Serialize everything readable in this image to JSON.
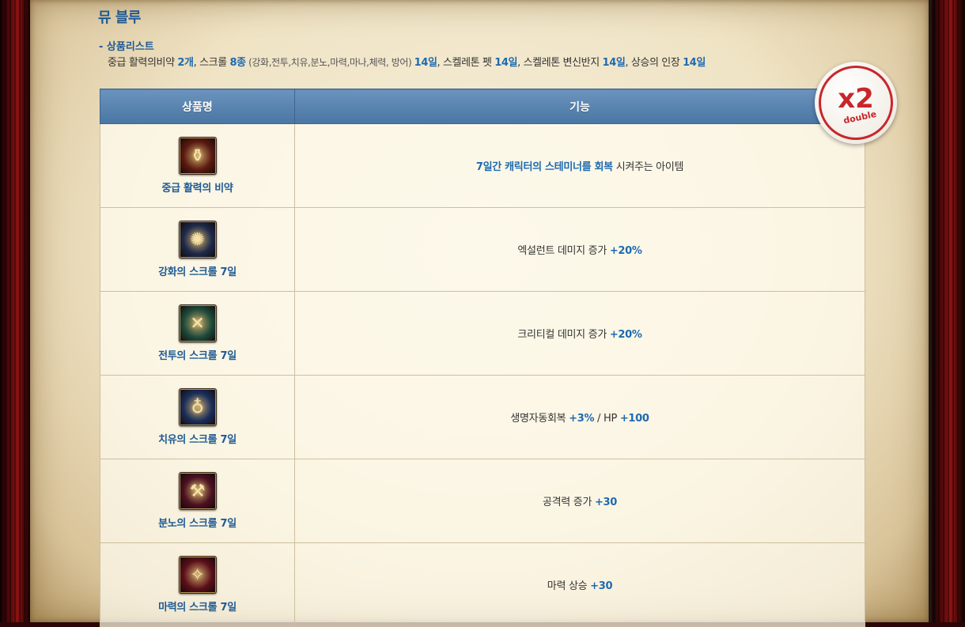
{
  "title": "뮤 블루",
  "list": {
    "heading": "- 상품리스트",
    "parts": [
      {
        "t": "중급 활력의비약 ",
        "c": ""
      },
      {
        "t": "2개",
        "c": "hl"
      },
      {
        "t": ", 스크롤 ",
        "c": ""
      },
      {
        "t": "8종",
        "c": "hl"
      },
      {
        "t": " (강화,전투,치유,분노,마력,마나,체력, 방어) ",
        "c": "muted"
      },
      {
        "t": "14일",
        "c": "hl"
      },
      {
        "t": ", 스켈레톤 펫 ",
        "c": ""
      },
      {
        "t": "14일",
        "c": "hl"
      },
      {
        "t": ", 스켈레톤 변신반지 ",
        "c": ""
      },
      {
        "t": "14일",
        "c": "hl"
      },
      {
        "t": ", 상승의 인장 ",
        "c": ""
      },
      {
        "t": "14일",
        "c": "hl"
      }
    ]
  },
  "badge": {
    "main": "x2",
    "word": "double"
  },
  "table": {
    "headers": [
      "상품명",
      "기능"
    ],
    "rows": [
      {
        "name": "중급 활력의 비약",
        "icon": "potion-icon",
        "glyph": "⚱",
        "bg": "#5a1a10",
        "parts": [
          {
            "t": "7일간 캐릭터의 스테미너를 회복",
            "c": "hl"
          },
          {
            "t": " 시켜주는 아이템",
            "c": ""
          }
        ]
      },
      {
        "name": "강화의 스크롤 7일",
        "icon": "scroll-enhance-icon",
        "glyph": "✺",
        "bg": "#1e2a4a",
        "parts": [
          {
            "t": "엑설런트 데미지 증가 ",
            "c": ""
          },
          {
            "t": "+20%",
            "c": "hl"
          }
        ]
      },
      {
        "name": "전투의 스크롤 7일",
        "icon": "scroll-battle-icon",
        "glyph": "✕",
        "bg": "#1d4a3a",
        "parts": [
          {
            "t": "크리티컬 데미지 증가 ",
            "c": ""
          },
          {
            "t": "+20%",
            "c": "hl"
          }
        ]
      },
      {
        "name": "치유의 스크롤 7일",
        "icon": "scroll-heal-icon",
        "glyph": "♁",
        "bg": "#1a2e5a",
        "parts": [
          {
            "t": "생명자동회복 ",
            "c": ""
          },
          {
            "t": "+3%",
            "c": "hl"
          },
          {
            "t": " / HP ",
            "c": ""
          },
          {
            "t": "+100",
            "c": "hl"
          }
        ]
      },
      {
        "name": "분노의 스크롤 7일",
        "icon": "scroll-rage-icon",
        "glyph": "⚒",
        "bg": "#4a1020",
        "parts": [
          {
            "t": "공격력 증가 ",
            "c": ""
          },
          {
            "t": "+30",
            "c": "hl"
          }
        ]
      },
      {
        "name": "마력의 스크롤 7일",
        "icon": "scroll-magic-icon",
        "glyph": "✧",
        "bg": "#5a0f1a",
        "parts": [
          {
            "t": "마력 상승 ",
            "c": ""
          },
          {
            "t": "+30",
            "c": "hl"
          }
        ]
      }
    ]
  }
}
